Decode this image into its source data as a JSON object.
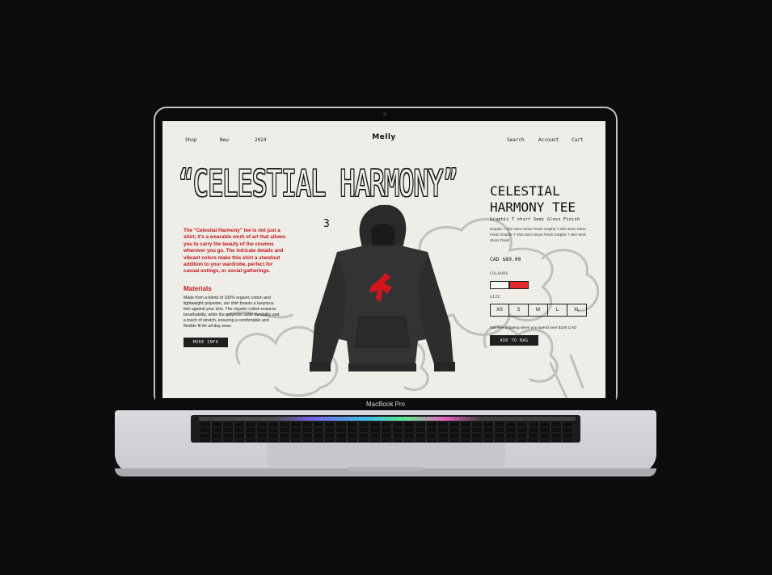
{
  "device": {
    "label": "MacBook Pro"
  },
  "site": {
    "logo": "Melly",
    "nav_left": [
      "Shop",
      "New",
      "2024"
    ],
    "nav_right": [
      "Search",
      "Account",
      "Cart"
    ]
  },
  "hero": {
    "headline": "“CELESTIAL HARMONY”",
    "footnote": "3"
  },
  "story": {
    "intro": "The “Celestial Harmony” tee is not just a shirt; it’s a wearable work of art that allows you to carry the beauty of the cosmos wherever you go. The intricate details and vibrant colors make this shirt a standout addition to your wardrobe, perfect for casual outings, or social gatherings.",
    "materials_title": "Materials",
    "materials_text": "Made from a blend of 100% organic cotton and lightweight polyester, our shirt boasts a luxurious feel against your skin. The organic cotton ensures breathability, while the polyester adds durability and a touch of stretch, ensuring a comfortable and flexible fit for all-day wear.",
    "more_info_label": "MORE INFO"
  },
  "product": {
    "title_line1": "CELESTIAL",
    "title_line2": "HARMONY TEE",
    "subtitle": "Graphic T shirt Semi Gloss Finish",
    "description": "Graphic T shirt Semi Gloss Finish Graphic T shirt Semi Gloss Finish Graphic T shirt Semi Gloss Finish Graphic T shirt Semi Gloss Finish",
    "price": "CAD $89.00",
    "colours_label": "COLOURS",
    "colours": [
      "#f7f7f4",
      "#e2272c"
    ],
    "size_label": "SIZE",
    "sizes": [
      "XS",
      "S",
      "M",
      "L",
      "XL"
    ],
    "shipping_note": "Get free shipping when you spend over $100 CAD",
    "add_to_bag_label": "ADD TO BAG"
  }
}
